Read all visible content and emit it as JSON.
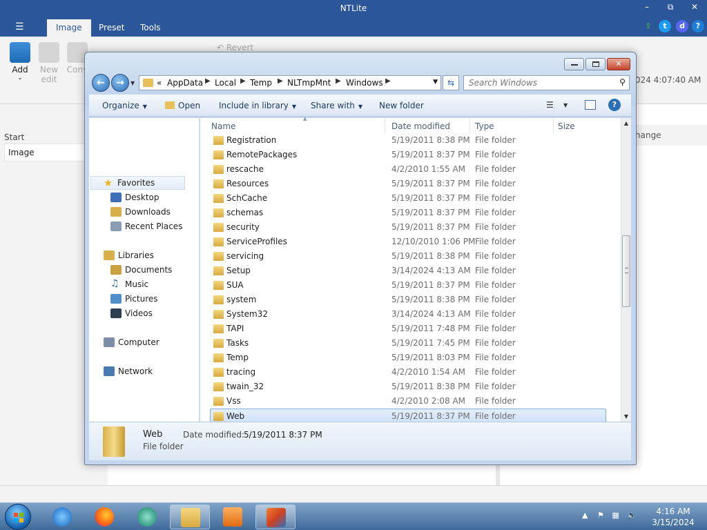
{
  "app": {
    "title": "NTLite",
    "menu_icon": "hamburger-icon",
    "tabs": [
      {
        "label": "Image",
        "active": true
      },
      {
        "label": "Preset",
        "active": false
      },
      {
        "label": "Tools",
        "active": false
      }
    ],
    "ribbon": {
      "add": "Add",
      "new_edit_1": "New",
      "new_edit_2": "edit",
      "convert": "Conv",
      "revert": "Revert"
    },
    "left": {
      "start": "Start",
      "image": "Image"
    },
    "right": {
      "change": "hange",
      "date": "024 4:07:40 AM"
    },
    "accent": "#2b579a"
  },
  "dialog": {
    "address": {
      "overflow": "«",
      "crumbs": [
        "AppData",
        "Local",
        "Temp",
        "NLTmpMnt",
        "Windows"
      ]
    },
    "search": {
      "placeholder": "Search Windows"
    },
    "toolbar": {
      "organize": "Organize",
      "open": "Open",
      "include": "Include in library",
      "share": "Share with",
      "new_folder": "New folder"
    },
    "nav": {
      "favorites": "Favorites",
      "desktop": "Desktop",
      "downloads": "Downloads",
      "recent": "Recent Places",
      "libraries": "Libraries",
      "documents": "Documents",
      "music": "Music",
      "pictures": "Pictures",
      "videos": "Videos",
      "computer": "Computer",
      "network": "Network"
    },
    "columns": {
      "name": "Name",
      "date": "Date modified",
      "type": "Type",
      "size": "Size"
    },
    "rows": [
      {
        "name": "Registration",
        "date": "5/19/2011 8:38 PM",
        "type": "File folder"
      },
      {
        "name": "RemotePackages",
        "date": "5/19/2011 8:37 PM",
        "type": "File folder"
      },
      {
        "name": "rescache",
        "date": "4/2/2010 1:55 AM",
        "type": "File folder"
      },
      {
        "name": "Resources",
        "date": "5/19/2011 8:37 PM",
        "type": "File folder"
      },
      {
        "name": "SchCache",
        "date": "5/19/2011 8:37 PM",
        "type": "File folder"
      },
      {
        "name": "schemas",
        "date": "5/19/2011 8:37 PM",
        "type": "File folder"
      },
      {
        "name": "security",
        "date": "5/19/2011 8:37 PM",
        "type": "File folder"
      },
      {
        "name": "ServiceProfiles",
        "date": "12/10/2010 1:06 PM",
        "type": "File folder"
      },
      {
        "name": "servicing",
        "date": "5/19/2011 8:38 PM",
        "type": "File folder"
      },
      {
        "name": "Setup",
        "date": "3/14/2024 4:13 AM",
        "type": "File folder"
      },
      {
        "name": "SUA",
        "date": "5/19/2011 8:37 PM",
        "type": "File folder"
      },
      {
        "name": "system",
        "date": "5/19/2011 8:38 PM",
        "type": "File folder"
      },
      {
        "name": "System32",
        "date": "3/14/2024 4:13 AM",
        "type": "File folder"
      },
      {
        "name": "TAPI",
        "date": "5/19/2011 7:48 PM",
        "type": "File folder"
      },
      {
        "name": "Tasks",
        "date": "5/19/2011 7:45 PM",
        "type": "File folder"
      },
      {
        "name": "Temp",
        "date": "5/19/2011 8:03 PM",
        "type": "File folder"
      },
      {
        "name": "tracing",
        "date": "4/2/2010 1:54 AM",
        "type": "File folder"
      },
      {
        "name": "twain_32",
        "date": "5/19/2011 8:38 PM",
        "type": "File folder"
      },
      {
        "name": "Vss",
        "date": "4/2/2010 2:08 AM",
        "type": "File folder"
      },
      {
        "name": "Web",
        "date": "5/19/2011 8:37 PM",
        "type": "File folder",
        "selected": true
      }
    ],
    "details": {
      "name": "Web",
      "type": "File folder",
      "date_label": "Date modified:",
      "date_value": "5/19/2011 8:37 PM"
    }
  },
  "taskbar": {
    "clock_time": "4:16 AM",
    "clock_date": "3/15/2024"
  }
}
